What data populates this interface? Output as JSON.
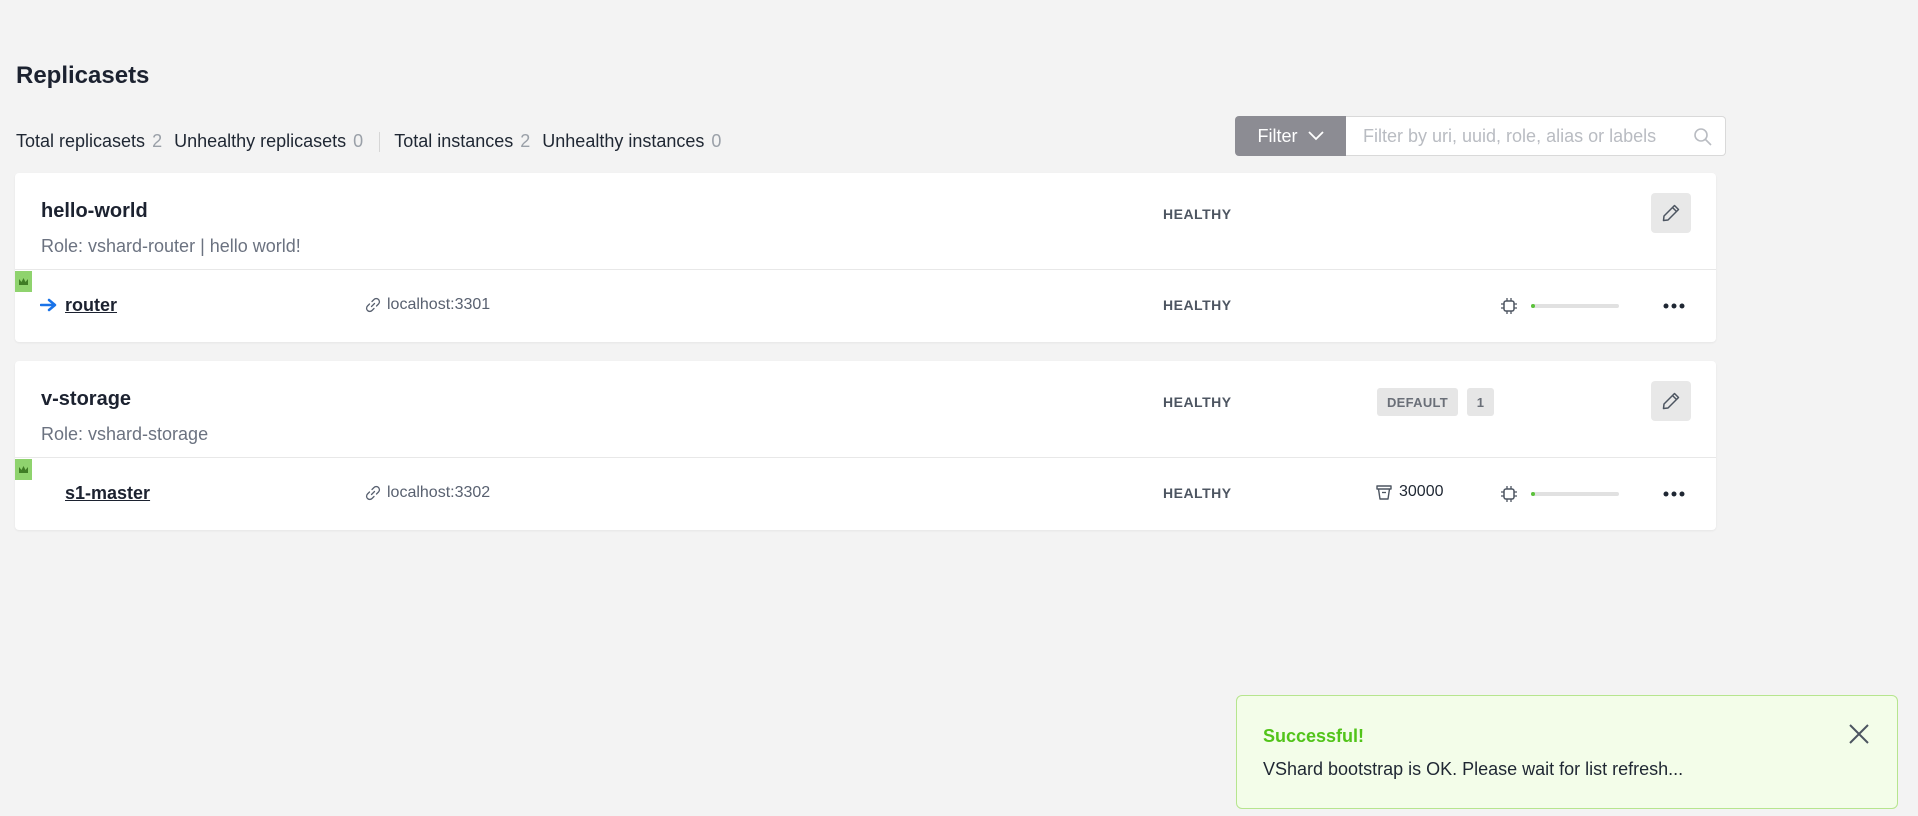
{
  "page": {
    "title": "Replicasets"
  },
  "stats": {
    "total_replicasets_label": "Total replicasets",
    "total_replicasets": "2",
    "unhealthy_replicasets_label": "Unhealthy replicasets",
    "unhealthy_replicasets": "0",
    "total_instances_label": "Total instances",
    "total_instances": "2",
    "unhealthy_instances_label": "Unhealthy instances",
    "unhealthy_instances": "0"
  },
  "filter": {
    "button_label": "Filter",
    "placeholder": "Filter by uri, uuid, role, alias or labels",
    "value": ""
  },
  "replicasets": [
    {
      "name": "hello-world",
      "role": "Role: vshard-router | hello world!",
      "status": "HEALTHY",
      "instances": [
        {
          "name": "router",
          "uri": "localhost:3301",
          "status": "HEALTHY",
          "leader": true,
          "is_self": true,
          "memory_usage": 0.05
        }
      ]
    },
    {
      "name": "v-storage",
      "role": "Role: vshard-storage",
      "status": "HEALTHY",
      "group_tag": "DEFAULT",
      "weight_tag": "1",
      "instances": [
        {
          "name": "s1-master",
          "uri": "localhost:3302",
          "status": "HEALTHY",
          "leader": true,
          "buckets": "30000",
          "memory_usage": 0.05
        }
      ]
    }
  ],
  "toast": {
    "title": "Successful!",
    "message": "VShard bootstrap is OK. Please wait for list refresh..."
  },
  "colors": {
    "healthy_fill": "#5cc23c",
    "leader_badge": "#8fd36e",
    "router_arrow": "#1a73e8",
    "toast_title": "#52c41a"
  },
  "icons": {
    "router": "arrow-right-icon",
    "uri": "link-icon",
    "bucket": "bucket-icon",
    "cpu": "cpu-icon",
    "edit": "pencil-icon",
    "more": "more-dots-icon",
    "leader": "crown-icon",
    "search": "search-icon",
    "close": "close-icon"
  }
}
